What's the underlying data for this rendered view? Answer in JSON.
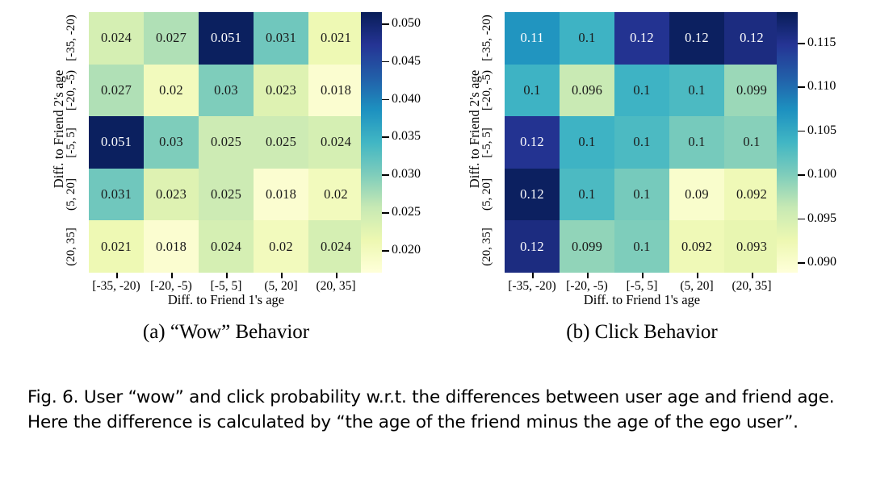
{
  "figure": {
    "caption": "Fig. 6.  User “wow” and click probability w.r.t. the differences between user age and friend age. Here the difference is calculated by “the age of the friend minus the age of the ego user”.",
    "subcaption_a": "(a) “Wow” Behavior",
    "subcaption_b": "(b) Click Behavior"
  },
  "chart_data": [
    {
      "type": "heatmap",
      "title": "(a) “Wow” Behavior",
      "xlabel": "Diff. to Friend 1's age",
      "ylabel": "Diff. to Friend 2's age",
      "x_categories": [
        "[-35, -20)",
        "[-20, -5)",
        "[-5, 5]",
        "(5, 20]",
        "(20, 35]"
      ],
      "y_categories": [
        "[-35, -20)",
        "[-20, -5)",
        "[-5, 5]",
        "(5, 20]",
        "(20, 35]"
      ],
      "values": [
        [
          0.024,
          0.027,
          0.051,
          0.031,
          0.021
        ],
        [
          0.027,
          0.02,
          0.03,
          0.023,
          0.018
        ],
        [
          0.051,
          0.03,
          0.025,
          0.025,
          0.024
        ],
        [
          0.031,
          0.023,
          0.025,
          0.018,
          0.02
        ],
        [
          0.021,
          0.018,
          0.024,
          0.02,
          0.024
        ]
      ],
      "cell_labels": [
        [
          "0.024",
          "0.027",
          "0.051",
          "0.031",
          "0.021"
        ],
        [
          "0.027",
          "0.02",
          "0.03",
          "0.023",
          "0.018"
        ],
        [
          "0.051",
          "0.03",
          "0.025",
          "0.025",
          "0.024"
        ],
        [
          "0.031",
          "0.023",
          "0.025",
          "0.018",
          "0.02"
        ],
        [
          "0.021",
          "0.018",
          "0.024",
          "0.02",
          "0.024"
        ]
      ],
      "colormap": "YlGnBu",
      "vmin": 0.017,
      "vmax": 0.0515,
      "colorbar_ticks": [
        "0.020",
        "0.025",
        "0.030",
        "0.035",
        "0.040",
        "0.045",
        "0.050"
      ],
      "colorbar_tick_values": [
        0.02,
        0.025,
        0.03,
        0.035,
        0.04,
        0.045,
        0.05
      ]
    },
    {
      "type": "heatmap",
      "title": "(b) Click Behavior",
      "xlabel": "Diff. to Friend 1's age",
      "ylabel": "Diff. to Friend 2's age",
      "x_categories": [
        "[-35, -20)",
        "[-20, -5)",
        "[-5, 5]",
        "(5, 20]",
        "(20, 35]"
      ],
      "y_categories": [
        "[-35, -20)",
        "[-20, -5)",
        "[-5, 5]",
        "(5, 20]",
        "(20, 35]"
      ],
      "values": [
        [
          0.107,
          0.104,
          0.115,
          0.118,
          0.116
        ],
        [
          0.104,
          0.096,
          0.104,
          0.103,
          0.0985
        ],
        [
          0.115,
          0.104,
          0.103,
          0.1005,
          0.0995
        ],
        [
          0.118,
          0.103,
          0.1005,
          0.09,
          0.092
        ],
        [
          0.116,
          0.099,
          0.1,
          0.092,
          0.093
        ]
      ],
      "cell_labels": [
        [
          "0.11",
          "0.1",
          "0.12",
          "0.12",
          "0.12"
        ],
        [
          "0.1",
          "0.096",
          "0.1",
          "0.1",
          "0.099"
        ],
        [
          "0.12",
          "0.1",
          "0.1",
          "0.1",
          "0.1"
        ],
        [
          "0.12",
          "0.1",
          "0.1",
          "0.09",
          "0.092"
        ],
        [
          "0.12",
          "0.099",
          "0.1",
          "0.092",
          "0.093"
        ]
      ],
      "colormap": "YlGnBu",
      "vmin": 0.0888,
      "vmax": 0.1185,
      "colorbar_ticks": [
        "0.090",
        "0.095",
        "0.100",
        "0.105",
        "0.110",
        "0.115"
      ],
      "colorbar_tick_values": [
        0.09,
        0.095,
        0.1,
        0.105,
        0.11,
        0.115
      ]
    }
  ]
}
